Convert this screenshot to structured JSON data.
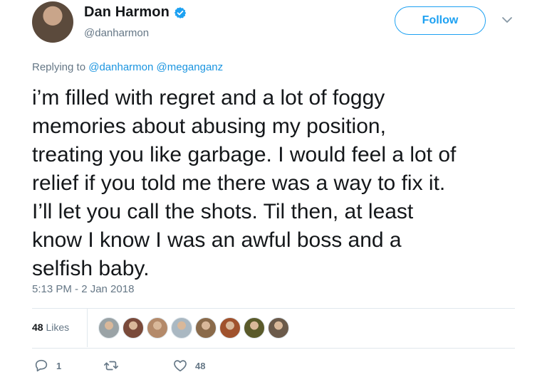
{
  "author": {
    "display_name": "Dan Harmon",
    "handle": "@danharmon",
    "verified": true
  },
  "follow_button": {
    "label": "Follow"
  },
  "reply_context": {
    "prefix": "Replying to ",
    "mentions": [
      "@danharmon",
      "@meganganz"
    ]
  },
  "tweet": {
    "text": "i’m filled with regret and a lot of foggy\nmemories about abusing my position,\ntreating you like garbage. I would feel a lot of\nrelief if you told me there was a way to fix it.\nI’ll let you call the shots. Til then, at least\nknow I know I was an awful boss and a\nselfish baby.",
    "timestamp": "5:13 PM - 2 Jan 2018"
  },
  "stats": {
    "likes_count": "48",
    "likes_label": "Likes",
    "liker_colors": [
      "#9aa3a6",
      "#7a4a3a",
      "#b48a6a",
      "#aab8c2",
      "#8a6a4a",
      "#a0522d",
      "#5a5a2a",
      "#6b5a4a"
    ]
  },
  "actions": {
    "reply_count": "1",
    "retweet_count": "",
    "like_count": "48"
  },
  "colors": {
    "accent": "#1da1f2",
    "secondary_text": "#657786",
    "divider": "#e1e8ed"
  },
  "icons": {
    "verified": "verified-badge-icon",
    "caret": "chevron-down-icon",
    "reply": "reply-icon",
    "retweet": "retweet-icon",
    "like": "heart-icon"
  }
}
